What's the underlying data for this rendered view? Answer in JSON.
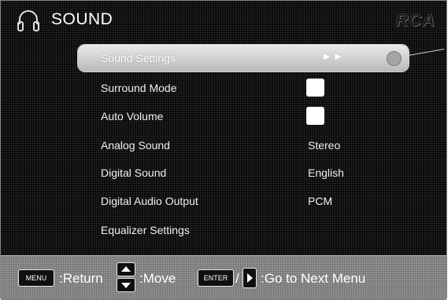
{
  "header": {
    "title": "SOUND",
    "brand": "RCA",
    "icon": "headphones-icon"
  },
  "menu": {
    "items": [
      {
        "label": "Sound Settings",
        "value": "",
        "control": "submenu",
        "selected": true
      },
      {
        "label": "Surround Mode",
        "value": "",
        "control": "checkbox",
        "checked": false
      },
      {
        "label": "Auto Volume",
        "value": "",
        "control": "checkbox",
        "checked": false
      },
      {
        "label": "Analog Sound",
        "value": "Stereo",
        "control": "option"
      },
      {
        "label": "Digital Sound",
        "value": "English",
        "control": "option"
      },
      {
        "label": "Digital Audio Output",
        "value": "PCM",
        "control": "option"
      },
      {
        "label": "Equalizer Settings",
        "value": "",
        "control": "submenu"
      }
    ],
    "selected_indicator": "▶ ▶"
  },
  "footer": {
    "menu_key": "MENU",
    "return_label": ":Return",
    "move_label": ":Move",
    "enter_key": "ENTER",
    "separator": "/",
    "next_label": ":Go to Next Menu"
  },
  "colors": {
    "background": "#080808",
    "footer": "#8f8f8f",
    "highlight": "#cfcfcf",
    "text": "#ffffff"
  }
}
